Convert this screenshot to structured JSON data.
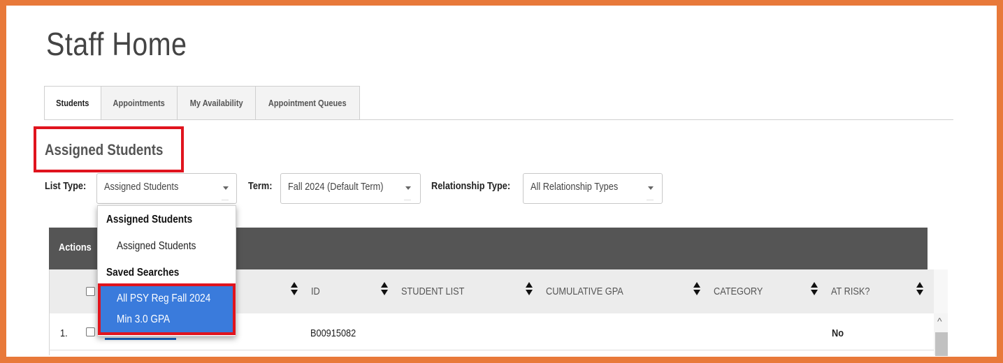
{
  "page": {
    "title": "Staff Home"
  },
  "tabs": [
    {
      "label": "Students",
      "active": true
    },
    {
      "label": "Appointments",
      "active": false
    },
    {
      "label": "My Availability",
      "active": false
    },
    {
      "label": "Appointment Queues",
      "active": false
    }
  ],
  "section": {
    "title": "Assigned Students"
  },
  "filters": {
    "list_type": {
      "label": "List Type:",
      "value": "Assigned Students"
    },
    "term": {
      "label": "Term:",
      "value": "Fall 2024 (Default Term)"
    },
    "relationship_type": {
      "label": "Relationship Type:",
      "value": "All Relationship Types"
    }
  },
  "dropdown": {
    "groups": [
      {
        "label": "Assigned Students",
        "items": [
          "Assigned Students"
        ]
      },
      {
        "label": "Saved Searches",
        "items": [
          "All PSY Reg Fall 2024 Min 3.0 GPA"
        ]
      }
    ],
    "selected_lines": [
      "All PSY Reg Fall 2024",
      "Min 3.0 GPA"
    ]
  },
  "table": {
    "actions_label": "Actions",
    "columns": [
      "ID",
      "Student List",
      "Cumulative GPA",
      "Category",
      "At Risk?"
    ],
    "rows": [
      {
        "index": "1.",
        "id": "B00915082",
        "student_list": "",
        "cumulative_gpa": "",
        "category": "",
        "at_risk": "No"
      }
    ]
  },
  "colors": {
    "frame": "#e8793a",
    "highlight": "#e0141e",
    "header_bar": "#555555",
    "selection": "#3a7bdc"
  },
  "icons": [
    "sort-icon",
    "caret-down-icon",
    "scroll-up-icon"
  ]
}
